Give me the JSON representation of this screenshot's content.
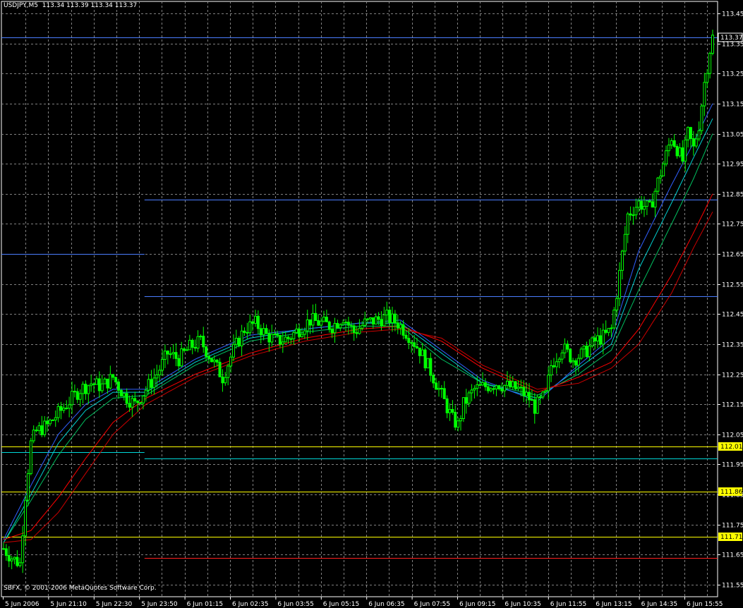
{
  "header": {
    "symbol": "USDJPY,M5",
    "ohlc": "113.34 113.39 113.34 113.37"
  },
  "copyright": "SBFX, © 2001-2006 MetaQuotes Software Corp.",
  "colors": {
    "background": "#000000",
    "grid": "#808080",
    "candle": "#00ff00",
    "ma_red": "#ff0000",
    "ma_darkred": "#cc0000",
    "ma_blue": "#3060ff",
    "ma_cyan": "#00d0d0",
    "ma_green": "#00c060",
    "level_blue": "#4a7dff",
    "level_cyan": "#00d8d8",
    "level_yellow": "#ffff00",
    "level_red": "#ff2020",
    "axis_text": "#ffffff",
    "price_marker_bg": "#ffff00"
  },
  "chart_data": {
    "type": "candlestick",
    "timeframe": "M5",
    "ylim": [
      111.51,
      113.49
    ],
    "y_ticks": [
      "113.45",
      "113.35",
      "113.25",
      "113.15",
      "113.05",
      "112.95",
      "112.85",
      "112.75",
      "112.65",
      "112.55",
      "112.45",
      "112.35",
      "112.25",
      "112.15",
      "112.05",
      "111.95",
      "111.85",
      "111.75",
      "111.65",
      "111.55"
    ],
    "x_ticks": [
      "5 Jun 2006",
      "5 Jun 21:10",
      "5 Jun 22:30",
      "5 Jun 23:50",
      "6 Jun 01:15",
      "6 Jun 02:35",
      "6 Jun 03:55",
      "6 Jun 05:15",
      "6 Jun 06:35",
      "6 Jun 07:55",
      "6 Jun 09:15",
      "6 Jun 10:35",
      "6 Jun 11:55",
      "6 Jun 13:15",
      "6 Jun 14:35",
      "6 Jun 15:55"
    ],
    "grid": true,
    "price_markers": [
      {
        "value": 113.37,
        "label": "113.37",
        "style": "current"
      },
      {
        "value": 112.01,
        "label": "112.01",
        "style": "yellow"
      },
      {
        "value": 111.86,
        "label": "111.86",
        "style": "yellow"
      },
      {
        "value": 111.71,
        "label": "111.71",
        "style": "yellow"
      }
    ],
    "levels": [
      {
        "value": 113.37,
        "color": "blue",
        "from_bar": 0,
        "to_bar": 260
      },
      {
        "value": 112.83,
        "color": "blue",
        "from_bar": 52,
        "to_bar": 260
      },
      {
        "value": 112.65,
        "color": "blue",
        "from_bar": 0,
        "to_bar": 52
      },
      {
        "value": 112.51,
        "color": "blue",
        "from_bar": 52,
        "to_bar": 260
      },
      {
        "value": 111.99,
        "color": "cyan",
        "from_bar": 0,
        "to_bar": 52
      },
      {
        "value": 111.97,
        "color": "cyan",
        "from_bar": 52,
        "to_bar": 260
      },
      {
        "value": 112.01,
        "color": "yellow",
        "from_bar": 0,
        "to_bar": 260
      },
      {
        "value": 111.86,
        "color": "yellow",
        "from_bar": 0,
        "to_bar": 260
      },
      {
        "value": 111.71,
        "color": "yellow",
        "from_bar": 0,
        "to_bar": 260
      },
      {
        "value": 111.64,
        "color": "red",
        "from_bar": 52,
        "to_bar": 260
      }
    ],
    "price_path": [
      [
        0,
        111.67
      ],
      [
        3,
        111.64
      ],
      [
        6,
        111.62
      ],
      [
        8,
        111.85
      ],
      [
        10,
        112.02
      ],
      [
        12,
        112.06
      ],
      [
        16,
        112.08
      ],
      [
        20,
        112.12
      ],
      [
        24,
        112.16
      ],
      [
        28,
        112.2
      ],
      [
        32,
        112.22
      ],
      [
        36,
        112.21
      ],
      [
        40,
        112.24
      ],
      [
        44,
        112.18
      ],
      [
        48,
        112.15
      ],
      [
        52,
        112.2
      ],
      [
        56,
        112.25
      ],
      [
        60,
        112.32
      ],
      [
        64,
        112.3
      ],
      [
        68,
        112.34
      ],
      [
        72,
        112.36
      ],
      [
        76,
        112.3
      ],
      [
        80,
        112.24
      ],
      [
        84,
        112.33
      ],
      [
        88,
        112.4
      ],
      [
        92,
        112.42
      ],
      [
        96,
        112.38
      ],
      [
        100,
        112.36
      ],
      [
        104,
        112.37
      ],
      [
        108,
        112.4
      ],
      [
        112,
        112.43
      ],
      [
        116,
        112.42
      ],
      [
        120,
        112.41
      ],
      [
        124,
        112.44
      ],
      [
        128,
        112.39
      ],
      [
        132,
        112.42
      ],
      [
        136,
        112.43
      ],
      [
        140,
        112.44
      ],
      [
        144,
        112.42
      ],
      [
        148,
        112.38
      ],
      [
        152,
        112.33
      ],
      [
        156,
        112.26
      ],
      [
        160,
        112.18
      ],
      [
        164,
        112.1
      ],
      [
        166,
        112.08
      ],
      [
        168,
        112.15
      ],
      [
        172,
        112.2
      ],
      [
        176,
        112.21
      ],
      [
        180,
        112.22
      ],
      [
        184,
        112.21
      ],
      [
        188,
        112.2
      ],
      [
        192,
        112.17
      ],
      [
        194,
        112.14
      ],
      [
        196,
        112.16
      ],
      [
        198,
        112.18
      ],
      [
        200,
        112.28
      ],
      [
        204,
        112.34
      ],
      [
        208,
        112.3
      ],
      [
        212,
        112.32
      ],
      [
        216,
        112.36
      ],
      [
        220,
        112.38
      ],
      [
        222,
        112.4
      ],
      [
        224,
        112.52
      ],
      [
        226,
        112.65
      ],
      [
        228,
        112.78
      ],
      [
        232,
        112.82
      ],
      [
        236,
        112.8
      ],
      [
        240,
        112.92
      ],
      [
        242,
        112.98
      ],
      [
        244,
        113.04
      ],
      [
        246,
        113.0
      ],
      [
        248,
        112.96
      ],
      [
        250,
        113.05
      ],
      [
        252,
        113.0
      ],
      [
        254,
        113.08
      ],
      [
        256,
        113.22
      ],
      [
        258,
        113.33
      ],
      [
        259,
        113.37
      ]
    ],
    "moving_averages": [
      {
        "color": "green",
        "points": [
          [
            0,
            111.69
          ],
          [
            10,
            111.83
          ],
          [
            20,
            111.98
          ],
          [
            30,
            112.1
          ],
          [
            40,
            112.17
          ],
          [
            52,
            112.18
          ],
          [
            70,
            112.28
          ],
          [
            90,
            112.36
          ],
          [
            110,
            112.39
          ],
          [
            130,
            112.41
          ],
          [
            145,
            112.41
          ],
          [
            160,
            112.3
          ],
          [
            175,
            112.22
          ],
          [
            195,
            112.18
          ],
          [
            210,
            112.25
          ],
          [
            222,
            112.33
          ],
          [
            232,
            112.53
          ],
          [
            244,
            112.75
          ],
          [
            252,
            112.9
          ],
          [
            259,
            113.05
          ]
        ]
      },
      {
        "color": "cyan",
        "points": [
          [
            0,
            111.69
          ],
          [
            10,
            111.85
          ],
          [
            20,
            112.02
          ],
          [
            30,
            112.13
          ],
          [
            40,
            112.19
          ],
          [
            52,
            112.19
          ],
          [
            70,
            112.29
          ],
          [
            90,
            112.37
          ],
          [
            110,
            112.4
          ],
          [
            130,
            112.42
          ],
          [
            145,
            112.42
          ],
          [
            160,
            112.32
          ],
          [
            175,
            112.22
          ],
          [
            195,
            112.17
          ],
          [
            210,
            112.27
          ],
          [
            222,
            112.35
          ],
          [
            232,
            112.6
          ],
          [
            244,
            112.82
          ],
          [
            252,
            112.97
          ],
          [
            259,
            113.1
          ]
        ]
      },
      {
        "color": "blue",
        "points": [
          [
            0,
            111.7
          ],
          [
            10,
            111.88
          ],
          [
            20,
            112.05
          ],
          [
            30,
            112.15
          ],
          [
            40,
            112.2
          ],
          [
            52,
            112.2
          ],
          [
            70,
            112.3
          ],
          [
            90,
            112.38
          ],
          [
            110,
            112.4
          ],
          [
            130,
            112.42
          ],
          [
            145,
            112.43
          ],
          [
            160,
            112.33
          ],
          [
            175,
            112.23
          ],
          [
            195,
            112.16
          ],
          [
            210,
            112.28
          ],
          [
            222,
            112.37
          ],
          [
            232,
            112.66
          ],
          [
            244,
            112.88
          ],
          [
            252,
            113.02
          ],
          [
            259,
            113.15
          ]
        ]
      },
      {
        "color": "red",
        "points": [
          [
            0,
            111.7
          ],
          [
            10,
            111.73
          ],
          [
            20,
            111.84
          ],
          [
            30,
            111.97
          ],
          [
            40,
            112.09
          ],
          [
            52,
            112.17
          ],
          [
            70,
            112.25
          ],
          [
            90,
            112.32
          ],
          [
            110,
            112.37
          ],
          [
            130,
            112.4
          ],
          [
            145,
            112.41
          ],
          [
            160,
            112.36
          ],
          [
            175,
            112.27
          ],
          [
            195,
            112.19
          ],
          [
            210,
            112.24
          ],
          [
            222,
            112.29
          ],
          [
            232,
            112.4
          ],
          [
            244,
            112.58
          ],
          [
            252,
            112.72
          ],
          [
            259,
            112.85
          ]
        ]
      },
      {
        "color": "darkred",
        "points": [
          [
            0,
            111.69
          ],
          [
            10,
            111.7
          ],
          [
            20,
            111.79
          ],
          [
            30,
            111.92
          ],
          [
            40,
            112.05
          ],
          [
            52,
            112.15
          ],
          [
            70,
            112.24
          ],
          [
            90,
            112.31
          ],
          [
            110,
            112.36
          ],
          [
            130,
            112.39
          ],
          [
            145,
            112.4
          ],
          [
            160,
            112.37
          ],
          [
            175,
            112.28
          ],
          [
            195,
            112.2
          ],
          [
            210,
            112.22
          ],
          [
            222,
            112.27
          ],
          [
            232,
            112.35
          ],
          [
            244,
            112.52
          ],
          [
            252,
            112.67
          ],
          [
            259,
            112.79
          ]
        ]
      }
    ]
  }
}
